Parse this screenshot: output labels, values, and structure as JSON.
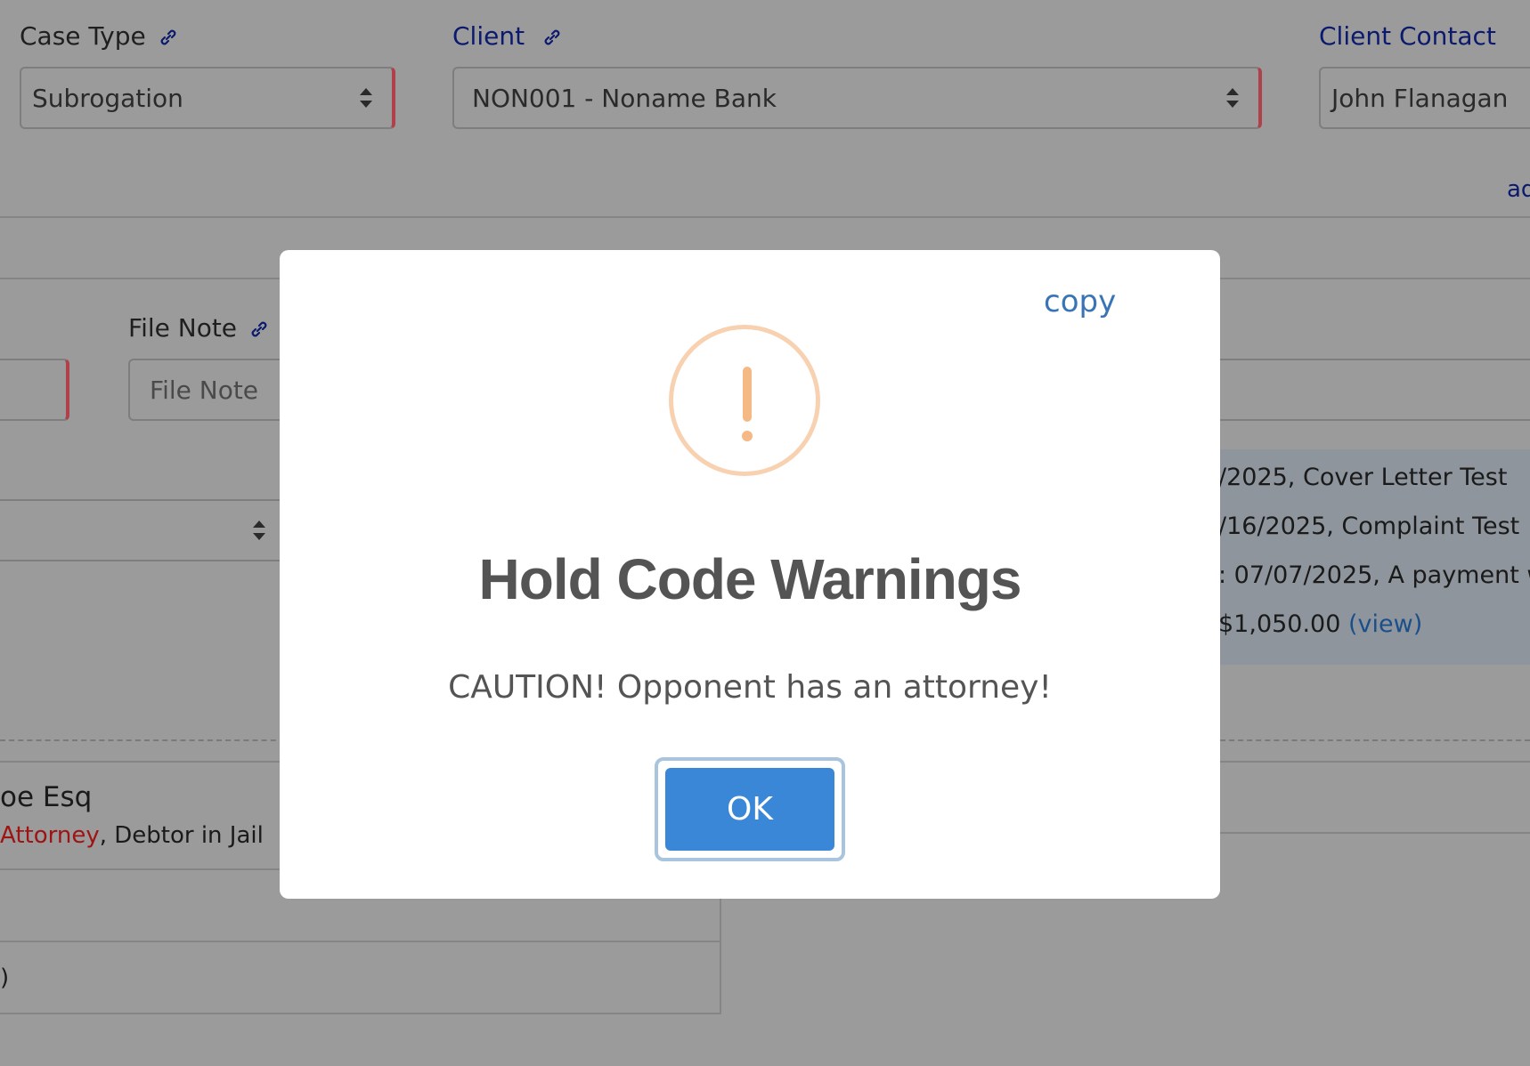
{
  "form": {
    "case_type": {
      "label": "Case Type",
      "value": "Subrogation"
    },
    "client": {
      "label": "Client",
      "value": "NON001 - Noname Bank"
    },
    "client_contact": {
      "label": "Client Contact",
      "value": "John Flanagan"
    },
    "add_link_partial": "ad",
    "file_note": {
      "label": "File Note",
      "placeholder": "File Note"
    }
  },
  "background_panel": {
    "lines": [
      "/2025, Cover Letter Test",
      "/16/2025, Complaint Test",
      ": 07/07/2025, A payment w",
      "$1,050.00"
    ],
    "view_link": "(view)"
  },
  "party": {
    "name_partial": "oe Esq",
    "attorney_tag": "Attorney",
    "separator": ", ",
    "jail_tag": "Debtor in Jail",
    "bottom_partial": ")"
  },
  "modal": {
    "copy_link": "copy",
    "title": "Hold Code Warnings",
    "message": "CAUTION! Opponent has an attorney!",
    "ok_label": "OK"
  },
  "colors": {
    "overlay_background": "#9b9b9b",
    "warning_icon": "#f5b985",
    "ok_button": "#3a87d8",
    "link": "#3a74b5",
    "required_marker": "#b0414a"
  }
}
